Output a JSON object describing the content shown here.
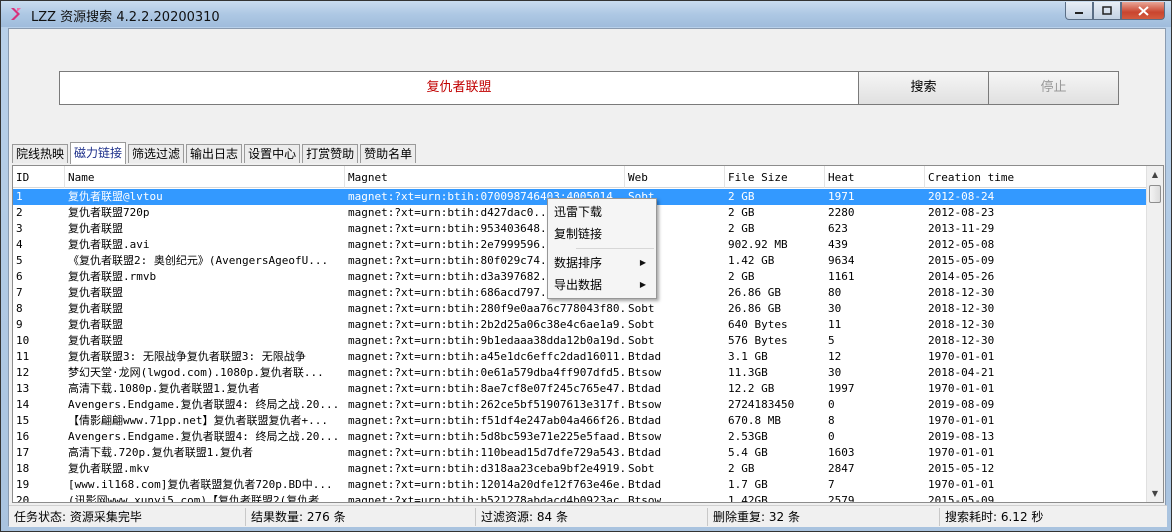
{
  "window": {
    "title": "LZZ 资源搜索 4.2.2.20200310",
    "controls": [
      "minimize",
      "maximize",
      "close"
    ]
  },
  "search": {
    "query": "复仇者联盟",
    "search_label": "搜索",
    "stop_label": "停止"
  },
  "tabs": [
    "院线热映",
    "磁力链接",
    "筛选过滤",
    "输出日志",
    "设置中心",
    "打赏赞助",
    "赞助名单"
  ],
  "active_tab": "磁力链接",
  "table": {
    "columns": [
      "ID",
      "Name",
      "Magnet",
      "Web",
      "File Size",
      "Heat",
      "Creation time"
    ],
    "rows": [
      {
        "id": "1",
        "name": "复仇者联盟@lvtou",
        "magnet": "magnet:?xt=urn:btih:070098746403:4005014...",
        "web": "Sobt",
        "size": "2 GB",
        "heat": "1971",
        "time": "2012-08-24"
      },
      {
        "id": "2",
        "name": "复仇者联盟720p",
        "magnet": "magnet:?xt=urn:btih:d427dac0...",
        "web": "",
        "size": "2 GB",
        "heat": "2280",
        "time": "2012-08-23"
      },
      {
        "id": "3",
        "name": "复仇者联盟",
        "magnet": "magnet:?xt=urn:btih:953403648...",
        "web": "",
        "size": "2 GB",
        "heat": "623",
        "time": "2013-11-29"
      },
      {
        "id": "4",
        "name": "复仇者联盟.avi",
        "magnet": "magnet:?xt=urn:btih:2e7999596...",
        "web": "",
        "size": "902.92 MB",
        "heat": "439",
        "time": "2012-05-08"
      },
      {
        "id": "5",
        "name": "《复仇者联盟2: 奥创纪元》(AvengersAgeofU...",
        "magnet": "magnet:?xt=urn:btih:80f029c74...",
        "web": "",
        "size": "1.42 GB",
        "heat": "9634",
        "time": "2015-05-09"
      },
      {
        "id": "6",
        "name": "复仇者联盟.rmvb",
        "magnet": "magnet:?xt=urn:btih:d3a397682...",
        "web": "",
        "size": "2 GB",
        "heat": "1161",
        "time": "2014-05-26"
      },
      {
        "id": "7",
        "name": "复仇者联盟",
        "magnet": "magnet:?xt=urn:btih:686acd797...",
        "web": "",
        "size": "26.86 GB",
        "heat": "80",
        "time": "2018-12-30"
      },
      {
        "id": "8",
        "name": "复仇者联盟",
        "magnet": "magnet:?xt=urn:btih:280f9e0aa76c778043f80...",
        "web": "Sobt",
        "size": "26.86 GB",
        "heat": "30",
        "time": "2018-12-30"
      },
      {
        "id": "9",
        "name": "复仇者联盟",
        "magnet": "magnet:?xt=urn:btih:2b2d25a06c38e4c6ae1a9...",
        "web": "Sobt",
        "size": "640 Bytes",
        "heat": "11",
        "time": "2018-12-30"
      },
      {
        "id": "10",
        "name": "复仇者联盟",
        "magnet": "magnet:?xt=urn:btih:9b1edaaa38dda12b0a19d...",
        "web": "Sobt",
        "size": "576 Bytes",
        "heat": "5",
        "time": "2018-12-30"
      },
      {
        "id": "11",
        "name": "复仇者联盟3: 无限战争复仇者联盟3: 无限战争",
        "magnet": "magnet:?xt=urn:btih:a45e1dc6effc2dad16011...",
        "web": "Btdad",
        "size": "3.1 GB",
        "heat": "12",
        "time": "1970-01-01"
      },
      {
        "id": "12",
        "name": "梦幻天堂·龙网(lwgod.com).1080p.复仇者联...",
        "magnet": "magnet:?xt=urn:btih:0e61a579dba4ff907dfd5...",
        "web": "Btsow",
        "size": "11.3GB",
        "heat": "30",
        "time": "2018-04-21"
      },
      {
        "id": "13",
        "name": "高清下载.1080p.复仇者联盟1.复仇者",
        "magnet": "magnet:?xt=urn:btih:8ae7cf8e07f245c765e47...",
        "web": "Btdad",
        "size": "12.2 GB",
        "heat": "1997",
        "time": "1970-01-01"
      },
      {
        "id": "14",
        "name": "Avengers.Endgame.复仇者联盟4: 终局之战.20...",
        "magnet": "magnet:?xt=urn:btih:262ce5bf51907613e317f...",
        "web": "Btsow",
        "size": "2724183450",
        "heat": "0",
        "time": "2019-08-09"
      },
      {
        "id": "15",
        "name": "【倩影翩翩www.71pp.net】复仇者联盟复仇者+...",
        "magnet": "magnet:?xt=urn:btih:f51df4e247ab04a466f26...",
        "web": "Btdad",
        "size": "670.8 MB",
        "heat": "8",
        "time": "1970-01-01"
      },
      {
        "id": "16",
        "name": "Avengers.Endgame.复仇者联盟4: 终局之战.20...",
        "magnet": "magnet:?xt=urn:btih:5d8bc593e71e225e5faad...",
        "web": "Btsow",
        "size": "2.53GB",
        "heat": "0",
        "time": "2019-08-13"
      },
      {
        "id": "17",
        "name": "高清下载.720p.复仇者联盟1.复仇者",
        "magnet": "magnet:?xt=urn:btih:110bead15d7dfe729a543...",
        "web": "Btdad",
        "size": "5.4 GB",
        "heat": "1603",
        "time": "1970-01-01"
      },
      {
        "id": "18",
        "name": "复仇者联盟.mkv",
        "magnet": "magnet:?xt=urn:btih:d318aa23ceba9bf2e4919...",
        "web": "Sobt",
        "size": "2 GB",
        "heat": "2847",
        "time": "2015-05-12"
      },
      {
        "id": "19",
        "name": "[www.il168.com]复仇者联盟复仇者720p.BD中...",
        "magnet": "magnet:?xt=urn:btih:12014a20dfe12f763e46e...",
        "web": "Btdad",
        "size": "1.7 GB",
        "heat": "7",
        "time": "1970-01-01"
      },
      {
        "id": "20",
        "name": "(讯影网www.xunyi5.com)【复仇者联盟2(复仇者...",
        "magnet": "magnet:?xt=urn:btih:b521278abdacd4b0923ac...",
        "web": "Btsow",
        "size": "1.42GB",
        "heat": "2579",
        "time": "2015-05-09"
      }
    ]
  },
  "context_menu": {
    "items": [
      {
        "label": "迅雷下载",
        "submenu": false
      },
      {
        "label": "复制链接",
        "submenu": false
      },
      {
        "label": "数据排序",
        "submenu": true
      },
      {
        "label": "导出数据",
        "submenu": true
      }
    ]
  },
  "status": {
    "task": "任务状态: 资源采集完毕",
    "results": "结果数量: 276 条",
    "filtered": "过滤资源: 84 条",
    "deduped": "删除重复: 32 条",
    "elapsed": "搜索耗时: 6.12 秒"
  },
  "colors": {
    "selection": "#3399ff",
    "query_text": "#c00000",
    "active_tab_text": "#1c2f8a"
  }
}
